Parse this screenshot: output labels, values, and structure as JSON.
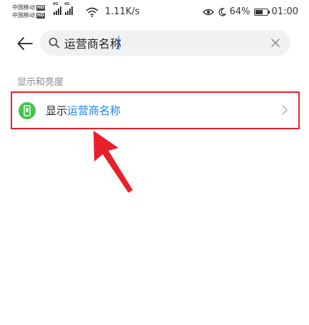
{
  "status_bar": {
    "carrier1": "中国移动",
    "carrier2": "中国移动",
    "hd_badge": "HD",
    "network_type": "4G",
    "net_speed": "1.11K/s",
    "battery": "64%",
    "battery_level": 0.64,
    "time": "01:00",
    "icons": [
      "eye-protection-icon",
      "moon-icon",
      "battery-icon",
      "wifi-icon",
      "signal-icon"
    ]
  },
  "search": {
    "value": "运营商名称",
    "placeholder": ""
  },
  "section": {
    "title": "显示和亮度"
  },
  "result": {
    "prefix": "显示",
    "highlight": "运营商名称"
  },
  "colors": {
    "highlight": "#1a82e8",
    "annotation_red": "#e8202a",
    "icon_green": "#44c44b"
  }
}
